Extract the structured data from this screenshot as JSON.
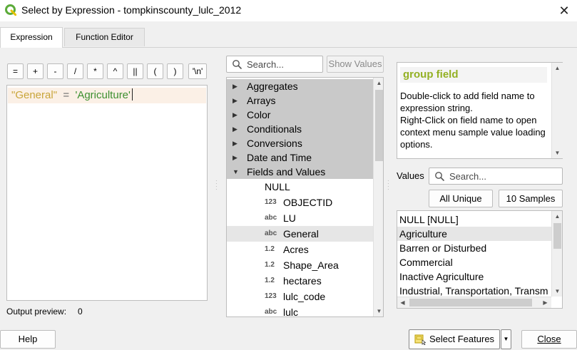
{
  "window": {
    "title": "Select by Expression - tompkinscounty_lulc_2012",
    "close_glyph": "✕"
  },
  "tabs": [
    {
      "label": "Expression",
      "active": true
    },
    {
      "label": "Function Editor",
      "active": false
    }
  ],
  "operators": [
    "=",
    "+",
    "-",
    "/",
    "*",
    "^",
    "||",
    "(",
    ")",
    "'\\n'"
  ],
  "editor": {
    "field": "\"General\"",
    "operator": "=",
    "value": "'Agriculture'"
  },
  "output_preview": {
    "label": "Output preview:",
    "value": "0"
  },
  "function_search": {
    "placeholder": "Search...",
    "show_values_label": "Show Values"
  },
  "tree": {
    "groups": [
      "Aggregates",
      "Arrays",
      "Color",
      "Conditionals",
      "Conversions",
      "Date and Time",
      "Fields and Values"
    ],
    "expanded_group": "Fields and Values",
    "fields": [
      {
        "type_badge": "",
        "label": "NULL"
      },
      {
        "type_badge": "123",
        "label": "OBJECTID"
      },
      {
        "type_badge": "abc",
        "label": "LU"
      },
      {
        "type_badge": "abc",
        "label": "General",
        "selected": true
      },
      {
        "type_badge": "1.2",
        "label": "Acres"
      },
      {
        "type_badge": "1.2",
        "label": "Shape_Area"
      },
      {
        "type_badge": "1.2",
        "label": "hectares"
      },
      {
        "type_badge": "123",
        "label": "lulc_code"
      },
      {
        "type_badge": "abc",
        "label": "lulc"
      }
    ]
  },
  "help": {
    "title": "group field",
    "lines": [
      "Double-click to add field name to",
      "expression string.",
      "Right-Click on field name to open",
      "context menu sample value loading",
      "options."
    ]
  },
  "values": {
    "label": "Values",
    "search_placeholder": "Search...",
    "all_unique_label": "All Unique",
    "samples_label": "10 Samples",
    "items": [
      "NULL [NULL]",
      "Agriculture",
      "Barren or Disturbed",
      "Commercial",
      "Inactive Agriculture",
      "Industrial, Transportation, Transm"
    ],
    "selected_index": 1
  },
  "footer": {
    "help_label": "Help",
    "select_features_label": "Select Features",
    "close_label": "Close"
  },
  "colors": {
    "field_token": "#c9a53a",
    "string_token": "#3c8f2f",
    "help_title": "#93b023",
    "app_icon": "#5cab3a"
  }
}
